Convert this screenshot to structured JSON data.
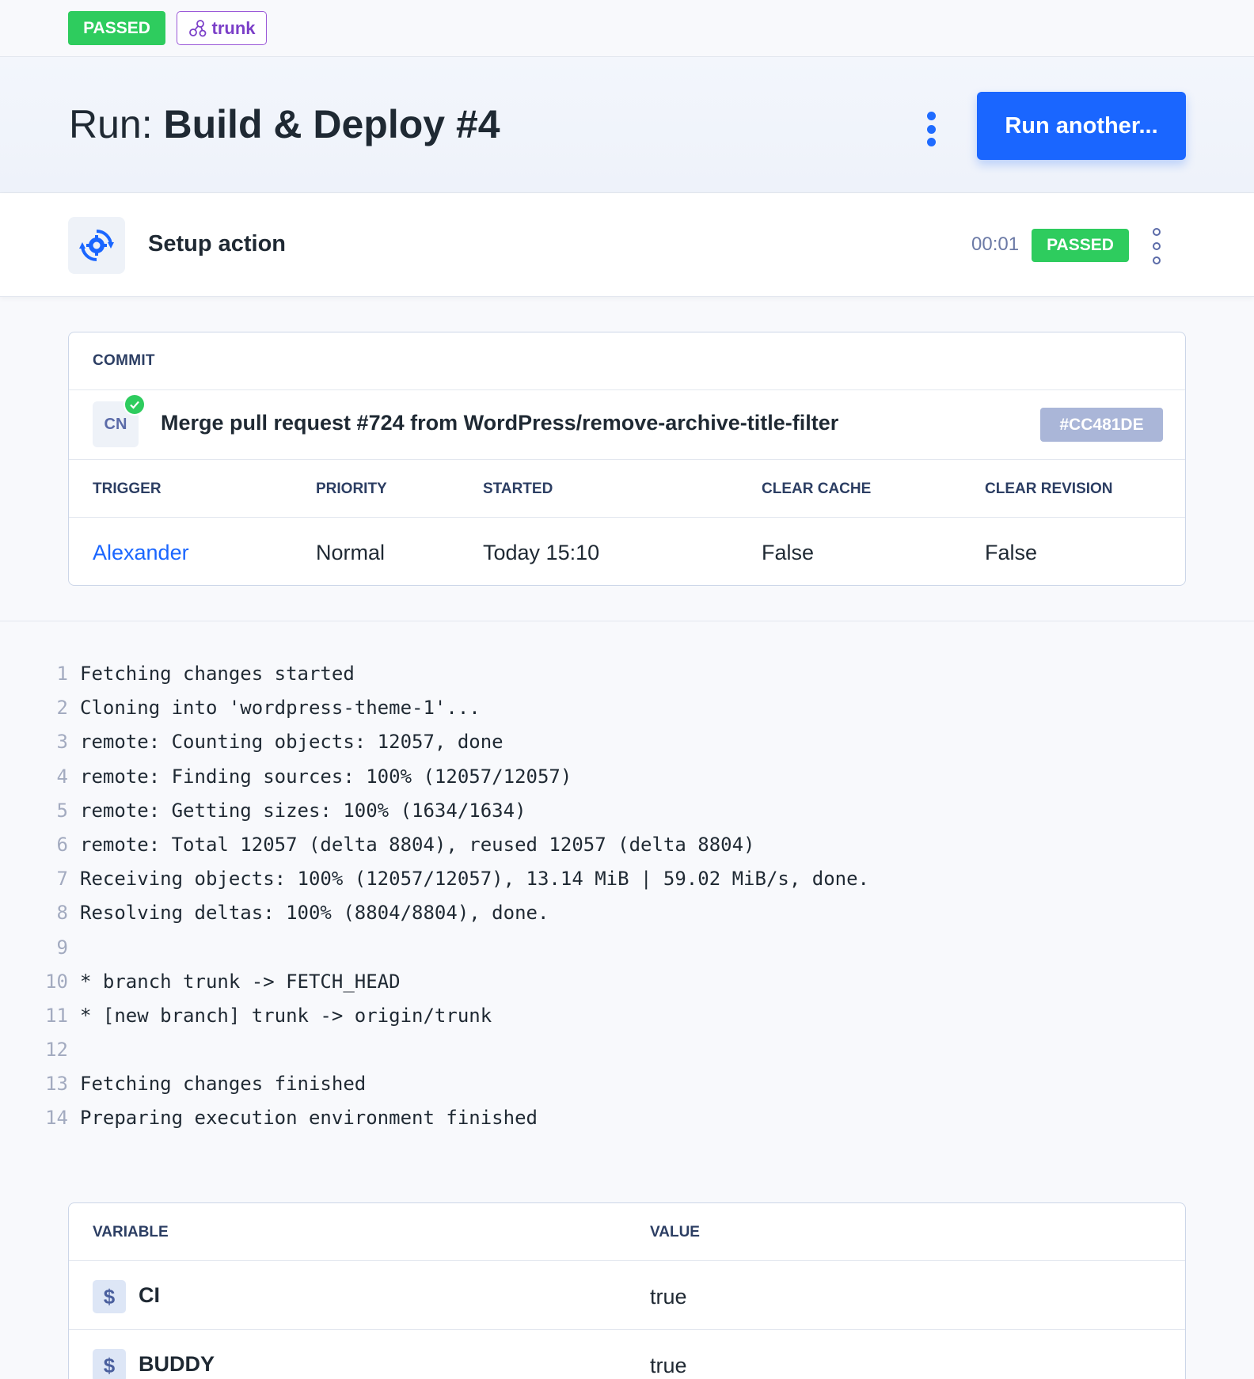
{
  "topbar": {
    "status": "PASSED",
    "branch": "trunk"
  },
  "header": {
    "title_prefix": "Run: ",
    "title_name": "Build & Deploy #4",
    "run_button": "Run another..."
  },
  "action": {
    "name": "Setup action",
    "duration": "00:01",
    "status": "PASSED"
  },
  "commit": {
    "section_label": "COMMIT",
    "avatar_initials": "CN",
    "message": "Merge pull request #724 from WordPress/remove-archive-title-filter",
    "hash": "#CC481DE",
    "headers": {
      "trigger": "TRIGGER",
      "priority": "PRIORITY",
      "started": "STARTED",
      "clear_cache": "CLEAR CACHE",
      "clear_revision": "CLEAR REVISION"
    },
    "values": {
      "trigger": "Alexander",
      "priority": "Normal",
      "started": "Today 15:10",
      "clear_cache": "False",
      "clear_revision": "False"
    }
  },
  "log": [
    {
      "n": "1",
      "text": "Fetching changes started"
    },
    {
      "n": "2",
      "text": "Cloning into 'wordpress-theme-1'..."
    },
    {
      "n": "3",
      "text": "remote: Counting objects: 12057, done"
    },
    {
      "n": "4",
      "text": "remote: Finding sources: 100% (12057/12057)"
    },
    {
      "n": "5",
      "text": "remote: Getting sizes: 100% (1634/1634)"
    },
    {
      "n": "6",
      "text": "remote: Total 12057 (delta 8804), reused 12057 (delta 8804)"
    },
    {
      "n": "7",
      "text": "Receiving objects: 100% (12057/12057), 13.14 MiB | 59.02 MiB/s, done."
    },
    {
      "n": "8",
      "text": "Resolving deltas: 100% (8804/8804), done."
    },
    {
      "n": "9",
      "text": ""
    },
    {
      "n": "10",
      "text": "* branch trunk -> FETCH_HEAD"
    },
    {
      "n": "11",
      "text": "* [new branch] trunk -> origin/trunk"
    },
    {
      "n": "12",
      "text": ""
    },
    {
      "n": "13",
      "text": "Fetching changes finished"
    },
    {
      "n": "14",
      "text": "Preparing execution environment finished"
    }
  ],
  "variables": {
    "headers": {
      "variable": "VARIABLE",
      "value": "VALUE"
    },
    "rows": [
      {
        "icon": "$",
        "name": "CI",
        "value": "true"
      },
      {
        "icon": "$",
        "name": "BUDDY",
        "value": "true"
      }
    ]
  },
  "colors": {
    "accent": "#1a66ff",
    "success": "#2ecc5e",
    "branch": "#7b3fc8"
  }
}
